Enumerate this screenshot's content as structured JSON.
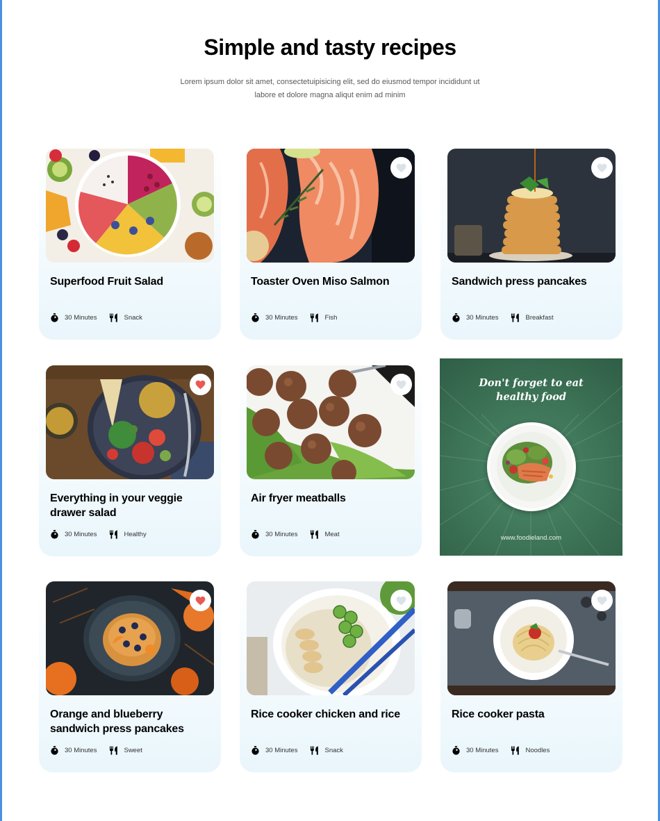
{
  "header": {
    "title": "Simple and tasty recipes",
    "subtitle": "Lorem ipsum dolor sit amet, consectetuipisicing elit, sed do eiusmod tempor incididunt ut labore et dolore magna aliqut enim ad minim"
  },
  "recipes": [
    {
      "name": "Superfood Fruit Salad",
      "time": "30 Minutes",
      "category": "Snack",
      "favorited": null,
      "image": "fruit-bowl"
    },
    {
      "name": "Toaster Oven Miso Salmon",
      "time": "30 Minutes",
      "category": "Fish",
      "favorited": false,
      "image": "salmon"
    },
    {
      "name": "Sandwich press pancakes",
      "time": "30 Minutes",
      "category": "Breakfast",
      "favorited": false,
      "image": "pancakes"
    },
    {
      "name": "Everything in your veggie drawer salad",
      "time": "30 Minutes",
      "category": "Healthy",
      "favorited": true,
      "image": "veggie-salad"
    },
    {
      "name": "Air fryer meatballs",
      "time": "30 Minutes",
      "category": "Meat",
      "favorited": false,
      "image": "meatballs"
    },
    {
      "name": "Orange and blueberry sandwich press pancakes",
      "time": "30 Minutes",
      "category": "Sweet",
      "favorited": true,
      "image": "orange-pancakes"
    },
    {
      "name": "Rice cooker chicken and rice",
      "time": "30 Minutes",
      "category": "Snack",
      "favorited": false,
      "image": "chicken-rice"
    },
    {
      "name": "Rice cooker pasta",
      "time": "30 Minutes",
      "category": "Noodles",
      "favorited": false,
      "image": "pasta"
    }
  ],
  "ad": {
    "title_line1": "Don't forget to eat",
    "title_line2": "healthy food",
    "url": "www.foodieland.com"
  },
  "icons": {
    "time": "timer-icon",
    "category": "fork-knife-icon",
    "favorite": "heart-icon"
  },
  "colors": {
    "heart_active": "#e95a52",
    "heart_inactive": "#dbe2e8",
    "card_gradient_bottom": "#e9f6fc",
    "ad_green": "#3f7659"
  }
}
